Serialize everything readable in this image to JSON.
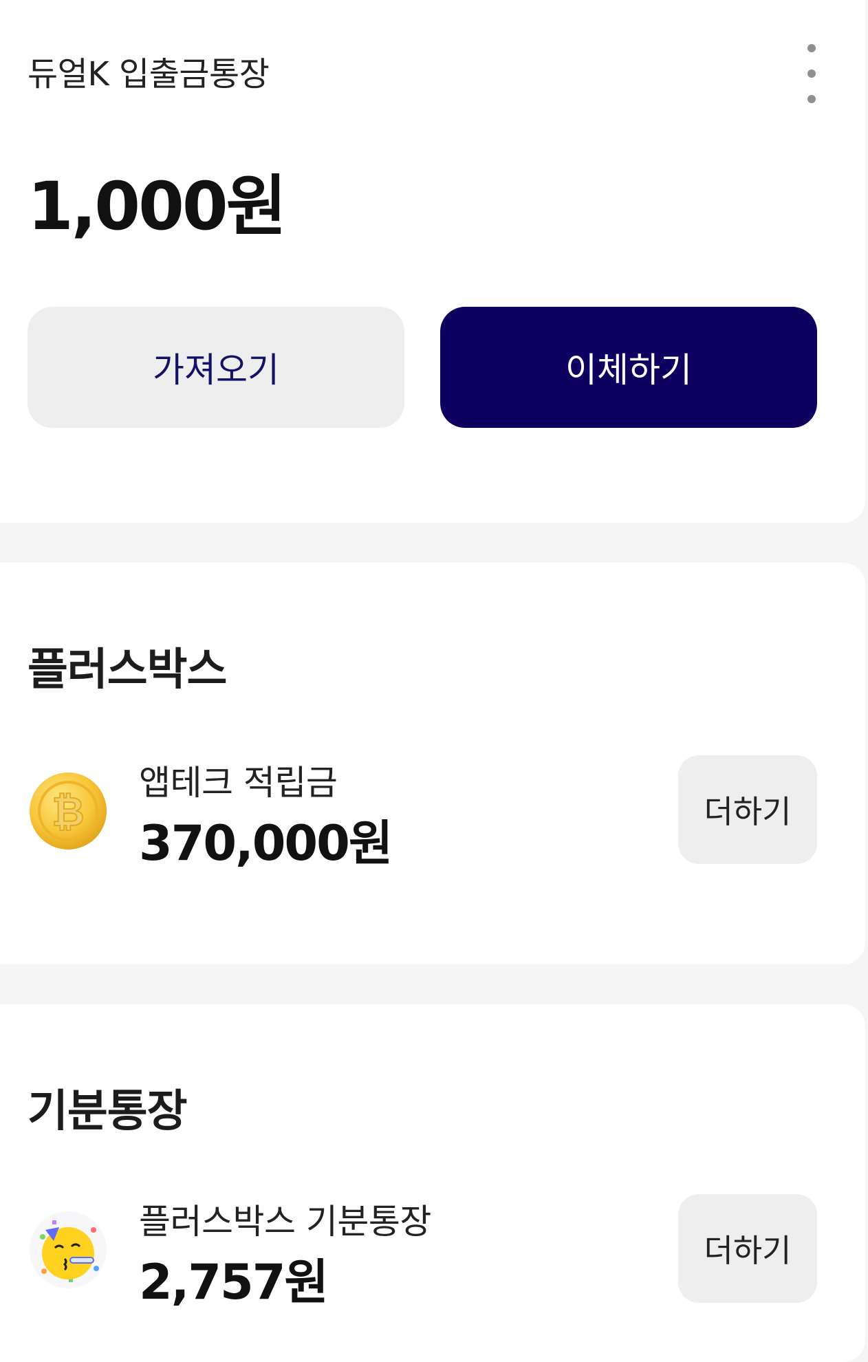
{
  "account": {
    "title": "듀얼K 입출금통장",
    "balance": "1,000원",
    "more_icon": "more-vertical-icon",
    "fetch_label": "가져오기",
    "transfer_label": "이체하기"
  },
  "plus_box": {
    "title": "플러스박스",
    "item": {
      "icon": "bitcoin-coin-icon",
      "name": "앱테크 적립금",
      "amount": "370,000원",
      "add_label": "더하기"
    }
  },
  "mood_account": {
    "title": "기분통장",
    "item": {
      "icon": "party-face-icon",
      "name": "플러스박스 기분통장",
      "amount": "2,757원",
      "add_label": "더하기"
    }
  },
  "colors": {
    "primary": "#0d005e",
    "secondary_button_bg": "#eeeeef",
    "secondary_button_text": "#141166",
    "background": "#f5f5f6"
  }
}
